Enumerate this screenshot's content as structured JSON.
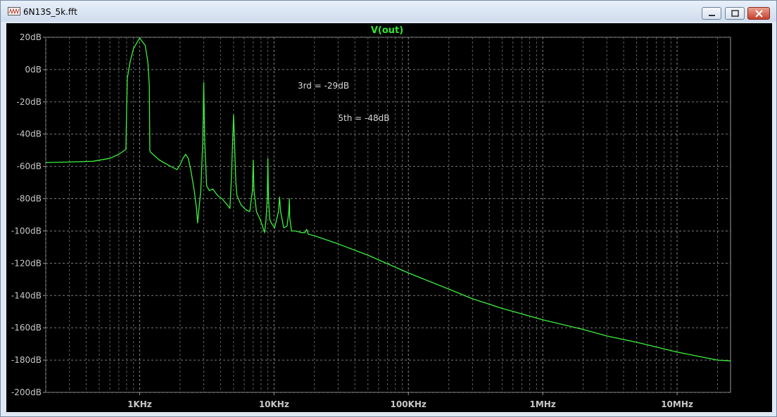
{
  "window": {
    "title": "6N13S_5k.fft"
  },
  "chart_data": {
    "type": "line",
    "title": "V(out)",
    "xscale": "log",
    "xlim": [
      200,
      25000000
    ],
    "ylim": [
      -200,
      20
    ],
    "grid": true,
    "x_ticks": [
      {
        "value": 1000,
        "label": "1KHz"
      },
      {
        "value": 10000,
        "label": "10KHz"
      },
      {
        "value": 100000,
        "label": "100KHz"
      },
      {
        "value": 1000000,
        "label": "1MHz"
      },
      {
        "value": 10000000,
        "label": "10MHz"
      }
    ],
    "y_ticks": [
      {
        "value": 20,
        "label": "20dB"
      },
      {
        "value": 0,
        "label": "0dB"
      },
      {
        "value": -20,
        "label": "-20dB"
      },
      {
        "value": -40,
        "label": "-40dB"
      },
      {
        "value": -60,
        "label": "-60dB"
      },
      {
        "value": -80,
        "label": "-80dB"
      },
      {
        "value": -100,
        "label": "-100dB"
      },
      {
        "value": -120,
        "label": "-120dB"
      },
      {
        "value": -140,
        "label": "-140dB"
      },
      {
        "value": -160,
        "label": "-160dB"
      },
      {
        "value": -180,
        "label": "-180dB"
      },
      {
        "value": -200,
        "label": "-200dB"
      }
    ],
    "annotations": [
      {
        "text": "3rd = -29dB",
        "x": 15000,
        "y": -10
      },
      {
        "text": "5th = -48dB",
        "x": 30000,
        "y": -30
      }
    ],
    "series": [
      {
        "color": "#3cf03c",
        "points": [
          [
            200,
            -57.6
          ],
          [
            300,
            -57.3
          ],
          [
            450,
            -56.8
          ],
          [
            600,
            -55
          ],
          [
            700,
            -52.5
          ],
          [
            790,
            -49.5
          ],
          [
            800,
            -25
          ],
          [
            810,
            -5
          ],
          [
            850,
            5
          ],
          [
            900,
            13
          ],
          [
            1000,
            19.5
          ],
          [
            1100,
            15
          ],
          [
            1150,
            5
          ],
          [
            1180,
            -10
          ],
          [
            1190,
            -50
          ],
          [
            1200,
            -51
          ],
          [
            1400,
            -56
          ],
          [
            1700,
            -60
          ],
          [
            1900,
            -62
          ],
          [
            2000,
            -59
          ],
          [
            2100,
            -55
          ],
          [
            2200,
            -52.5
          ],
          [
            2300,
            -55
          ],
          [
            2400,
            -62
          ],
          [
            2550,
            -75
          ],
          [
            2650,
            -86
          ],
          [
            2700,
            -95
          ],
          [
            2750,
            -88
          ],
          [
            2850,
            -75
          ],
          [
            2950,
            -45
          ],
          [
            3000,
            -8
          ],
          [
            3050,
            -45
          ],
          [
            3150,
            -72
          ],
          [
            3300,
            -75
          ],
          [
            3500,
            -74
          ],
          [
            3800,
            -78
          ],
          [
            4100,
            -80
          ],
          [
            4400,
            -83
          ],
          [
            4700,
            -86
          ],
          [
            4800,
            -70
          ],
          [
            5000,
            -28
          ],
          [
            5200,
            -70
          ],
          [
            5300,
            -78
          ],
          [
            5700,
            -84
          ],
          [
            6200,
            -87
          ],
          [
            6600,
            -88
          ],
          [
            6900,
            -75
          ],
          [
            7000,
            -56
          ],
          [
            7100,
            -75
          ],
          [
            7400,
            -88
          ],
          [
            7900,
            -93
          ],
          [
            8200,
            -97
          ],
          [
            8500,
            -101
          ],
          [
            8700,
            -94
          ],
          [
            8900,
            -80
          ],
          [
            9000,
            -55
          ],
          [
            9100,
            -80
          ],
          [
            9300,
            -93
          ],
          [
            9700,
            -96
          ],
          [
            10100,
            -98
          ],
          [
            10800,
            -88
          ],
          [
            11000,
            -79
          ],
          [
            11200,
            -88
          ],
          [
            11800,
            -98
          ],
          [
            12500,
            -97
          ],
          [
            12900,
            -88
          ],
          [
            13000,
            -80
          ],
          [
            13100,
            -92
          ],
          [
            13500,
            -100
          ],
          [
            14500,
            -100
          ],
          [
            16000,
            -101
          ],
          [
            17000,
            -101
          ],
          [
            17500,
            -99
          ],
          [
            18000,
            -102
          ],
          [
            20000,
            -103
          ],
          [
            30000,
            -108
          ],
          [
            50000,
            -115
          ],
          [
            100000,
            -126
          ],
          [
            200000,
            -136
          ],
          [
            300000,
            -142
          ],
          [
            500000,
            -148
          ],
          [
            1000000,
            -155
          ],
          [
            2000000,
            -161
          ],
          [
            3000000,
            -165
          ],
          [
            5000000,
            -169
          ],
          [
            10000000,
            -175
          ],
          [
            20000000,
            -180
          ],
          [
            25000000,
            -180.5
          ]
        ]
      }
    ]
  }
}
